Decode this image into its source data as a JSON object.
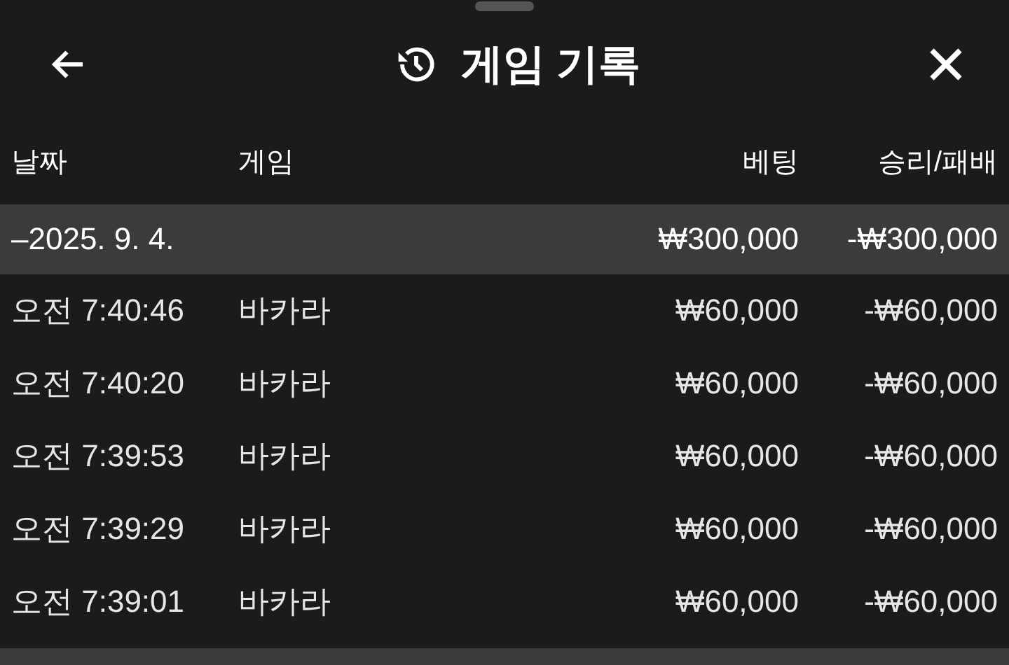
{
  "header": {
    "title": "게임 기록"
  },
  "table": {
    "columns": [
      "날짜",
      "게임",
      "베팅",
      "승리/패배"
    ],
    "group": {
      "date": "–2025. 9. 4.",
      "bet": "₩300,000",
      "result": "-₩300,000"
    },
    "rows": [
      {
        "time": "오전 7:40:46",
        "game": "바카라",
        "bet": "₩60,000",
        "result": "-₩60,000"
      },
      {
        "time": "오전 7:40:20",
        "game": "바카라",
        "bet": "₩60,000",
        "result": "-₩60,000"
      },
      {
        "time": "오전 7:39:53",
        "game": "바카라",
        "bet": "₩60,000",
        "result": "-₩60,000"
      },
      {
        "time": "오전 7:39:29",
        "game": "바카라",
        "bet": "₩60,000",
        "result": "-₩60,000"
      },
      {
        "time": "오전 7:39:01",
        "game": "바카라",
        "bet": "₩60,000",
        "result": "-₩60,000"
      }
    ]
  }
}
